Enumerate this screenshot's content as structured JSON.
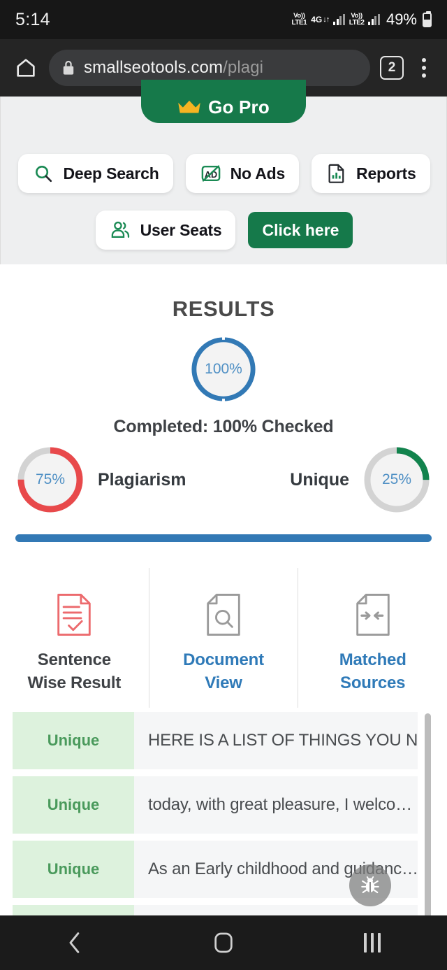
{
  "status_bar": {
    "time": "5:14",
    "volte1_top": "Vo))",
    "volte1_bottom": "LTE1",
    "network_gen": "4G",
    "data_arrows": "↓↑",
    "volte2_top": "Vo))",
    "volte2_bottom": "LTE2",
    "battery_percent": "49%",
    "signal_icon": "signal-bars-icon",
    "battery_icon": "battery-icon"
  },
  "browser_bar": {
    "home_icon": "home-icon",
    "lock_icon": "lock-icon",
    "url_visible": "smallseotools.com",
    "url_dim": "/plagi",
    "tab_count": "2",
    "menu_icon": "kebab-menu-icon"
  },
  "promo": {
    "go_pro_label": "Go Pro",
    "crown_icon": "crown-icon",
    "features": [
      {
        "label": "Deep Search",
        "icon": "magnifier-icon"
      },
      {
        "label": "No Ads",
        "icon": "no-ads-icon"
      },
      {
        "label": "Reports",
        "icon": "report-document-icon"
      },
      {
        "label": "User Seats",
        "icon": "users-icon"
      }
    ],
    "cta_label": "Click here",
    "background_color": "#eeeff0",
    "brand_green": "#15794a"
  },
  "results": {
    "title": "RESULTS",
    "main_gauge": {
      "value": "100%",
      "percent": 100,
      "color": "#3279b5"
    },
    "completed_text": "Completed: 100% Checked",
    "gauges": [
      {
        "label": "Plagiarism",
        "value": "75%",
        "percent": 75,
        "color": "#e8494b",
        "track": "#d3d3d3"
      },
      {
        "label": "Unique",
        "value": "25%",
        "percent": 25,
        "color": "#12834d",
        "track": "#d3d3d3"
      }
    ],
    "divider_color": "#3279b5"
  },
  "tabs": [
    {
      "label_line1": "Sentence",
      "label_line2": "Wise Result",
      "icon": "document-check-icon",
      "active": true
    },
    {
      "label_line1": "Document",
      "label_line2": "View",
      "icon": "document-search-icon",
      "active": false
    },
    {
      "label_line1": "Matched",
      "label_line2": "Sources",
      "icon": "document-arrows-icon",
      "active": false
    }
  ],
  "sentence_list": [
    {
      "tag": "Unique",
      "sentence": "HERE IS A LIST OF THINGS YOU N…"
    },
    {
      "tag": "Unique",
      "sentence": "today, with great pleasure, I welco…"
    },
    {
      "tag": "Unique",
      "sentence": "As an Early childhood and guidanc…"
    },
    {
      "tag": "",
      "sentence": ""
    }
  ],
  "fab": {
    "icon": "bug-icon"
  },
  "nav_bar": {
    "back_icon": "back-chevron-icon",
    "home_icon": "home-square-icon",
    "recents_icon": "recents-icon"
  }
}
